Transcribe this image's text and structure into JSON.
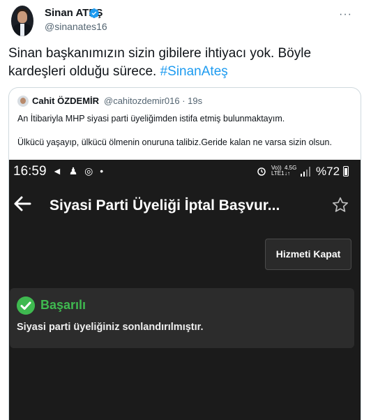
{
  "tweet": {
    "author_name": "Sinan ATEŞ",
    "author_handle": "@sinanates16",
    "more_label": "···",
    "text": "Sinan başkanımızın sizin gibilere ihtiyacı yok. Böyle kardeşleri olduğu sürece. ",
    "hashtag": "#SinanAteş"
  },
  "quote": {
    "author_name": "Cahit ÖZDEMİR",
    "meta": "@cahitozdemir016 · 19s",
    "line1": "An İtibariyla MHP siyasi parti üyeliğimden istifa etmiş bulunmaktayım.",
    "line2": "Ülkücü yaşayıp, ülkücü ölmenin onuruna talibiz.Geride kalan ne varsa sizin olsun."
  },
  "screenshot": {
    "status": {
      "time": "16:59",
      "left_icons": "◄ ♟ ◎ •",
      "net_top": "Vo))",
      "net_bottom": "LTE1",
      "net2_top": "4.5G",
      "net2_bottom": "↓↑",
      "battery_pct": "%72"
    },
    "app_title": "Siyasi Parti Üyeliği İptal Başvur...",
    "close_button": "Hizmeti Kapat",
    "alert": {
      "title": "Başarılı",
      "message": "Siyasi parti üyeliğiniz sonlandırılmıştır."
    }
  },
  "colors": {
    "accent": "#1d9bf0",
    "success": "#3fb950"
  }
}
